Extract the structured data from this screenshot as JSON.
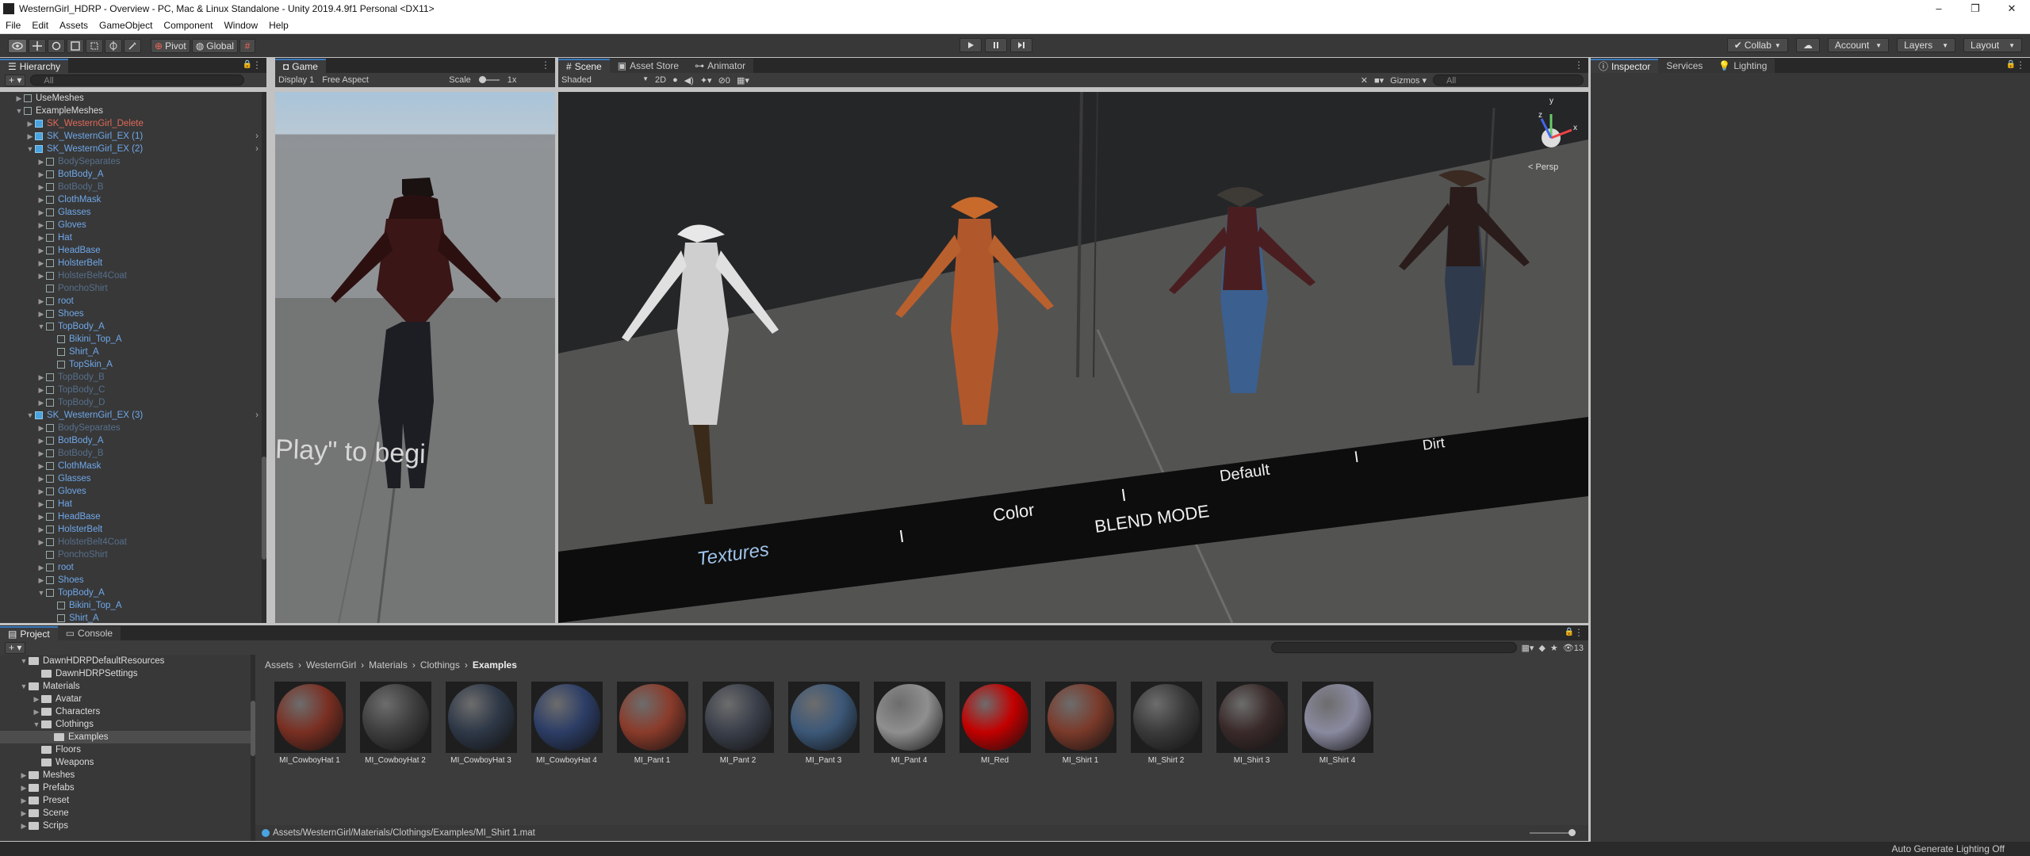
{
  "window": {
    "title": "WesternGirl_HDRP - Overview - PC, Mac & Linux Standalone - Unity 2019.4.9f1 Personal <DX11>",
    "controls": [
      "–",
      "❐",
      "✕"
    ]
  },
  "menubar": [
    "File",
    "Edit",
    "Assets",
    "GameObject",
    "Component",
    "Window",
    "Help"
  ],
  "toolbar": {
    "pivot": "Pivot",
    "global": "Global",
    "collab": "Collab",
    "account": "Account",
    "layers": "Layers",
    "layout": "Layout"
  },
  "hierarchy": {
    "tab": "Hierarchy",
    "search_placeholder": "All",
    "rows": [
      {
        "label": "UseMeshes",
        "indent": 1,
        "color": "#dcdcdc",
        "arrow": "▶",
        "icon": "go"
      },
      {
        "label": "ExampleMeshes",
        "indent": 1,
        "color": "#dcdcdc",
        "arrow": "▼",
        "icon": "go"
      },
      {
        "label": "SK_WesternGirl_Delete",
        "indent": 2,
        "color": "#e06a5a",
        "arrow": "▶",
        "icon": "prefab"
      },
      {
        "label": "SK_WesternGirl_EX (1)",
        "indent": 2,
        "color": "#6fa8ea",
        "arrow": "▶",
        "icon": "prefab"
      },
      {
        "label": "SK_WesternGirl_EX (2)",
        "indent": 2,
        "color": "#6fa8ea",
        "arrow": "▼",
        "icon": "prefab"
      },
      {
        "label": "BodySeparates",
        "indent": 3,
        "color": "#566f8c",
        "arrow": "▶",
        "icon": "go"
      },
      {
        "label": "BotBody_A",
        "indent": 3,
        "color": "#6fa8ea",
        "arrow": "▶",
        "icon": "go"
      },
      {
        "label": "BotBody_B",
        "indent": 3,
        "color": "#566f8c",
        "arrow": "▶",
        "icon": "go"
      },
      {
        "label": "ClothMask",
        "indent": 3,
        "color": "#6fa8ea",
        "arrow": "▶",
        "icon": "go"
      },
      {
        "label": "Glasses",
        "indent": 3,
        "color": "#6fa8ea",
        "arrow": "▶",
        "icon": "go"
      },
      {
        "label": "Gloves",
        "indent": 3,
        "color": "#6fa8ea",
        "arrow": "▶",
        "icon": "go"
      },
      {
        "label": "Hat",
        "indent": 3,
        "color": "#6fa8ea",
        "arrow": "▶",
        "icon": "go"
      },
      {
        "label": "HeadBase",
        "indent": 3,
        "color": "#6fa8ea",
        "arrow": "▶",
        "icon": "go"
      },
      {
        "label": "HolsterBelt",
        "indent": 3,
        "color": "#6fa8ea",
        "arrow": "▶",
        "icon": "go"
      },
      {
        "label": "HolsterBelt4Coat",
        "indent": 3,
        "color": "#566f8c",
        "arrow": "▶",
        "icon": "go"
      },
      {
        "label": "PonchoShirt",
        "indent": 3,
        "color": "#566f8c",
        "arrow": "",
        "icon": "go"
      },
      {
        "label": "root",
        "indent": 3,
        "color": "#6fa8ea",
        "arrow": "▶",
        "icon": "go"
      },
      {
        "label": "Shoes",
        "indent": 3,
        "color": "#6fa8ea",
        "arrow": "▶",
        "icon": "go"
      },
      {
        "label": "TopBody_A",
        "indent": 3,
        "color": "#6fa8ea",
        "arrow": "▼",
        "icon": "go"
      },
      {
        "label": "Bikini_Top_A",
        "indent": 4,
        "color": "#6fa8ea",
        "arrow": "",
        "icon": "go"
      },
      {
        "label": "Shirt_A",
        "indent": 4,
        "color": "#6fa8ea",
        "arrow": "",
        "icon": "go"
      },
      {
        "label": "TopSkin_A",
        "indent": 4,
        "color": "#6fa8ea",
        "arrow": "",
        "icon": "go"
      },
      {
        "label": "TopBody_B",
        "indent": 3,
        "color": "#566f8c",
        "arrow": "▶",
        "icon": "go"
      },
      {
        "label": "TopBody_C",
        "indent": 3,
        "color": "#566f8c",
        "arrow": "▶",
        "icon": "go"
      },
      {
        "label": "TopBody_D",
        "indent": 3,
        "color": "#566f8c",
        "arrow": "▶",
        "icon": "go"
      },
      {
        "label": "SK_WesternGirl_EX (3)",
        "indent": 2,
        "color": "#6fa8ea",
        "arrow": "▼",
        "icon": "prefab"
      },
      {
        "label": "BodySeparates",
        "indent": 3,
        "color": "#566f8c",
        "arrow": "▶",
        "icon": "go"
      },
      {
        "label": "BotBody_A",
        "indent": 3,
        "color": "#6fa8ea",
        "arrow": "▶",
        "icon": "go"
      },
      {
        "label": "BotBody_B",
        "indent": 3,
        "color": "#566f8c",
        "arrow": "▶",
        "icon": "go"
      },
      {
        "label": "ClothMask",
        "indent": 3,
        "color": "#6fa8ea",
        "arrow": "▶",
        "icon": "go"
      },
      {
        "label": "Glasses",
        "indent": 3,
        "color": "#6fa8ea",
        "arrow": "▶",
        "icon": "go"
      },
      {
        "label": "Gloves",
        "indent": 3,
        "color": "#6fa8ea",
        "arrow": "▶",
        "icon": "go"
      },
      {
        "label": "Hat",
        "indent": 3,
        "color": "#6fa8ea",
        "arrow": "▶",
        "icon": "go"
      },
      {
        "label": "HeadBase",
        "indent": 3,
        "color": "#6fa8ea",
        "arrow": "▶",
        "icon": "go"
      },
      {
        "label": "HolsterBelt",
        "indent": 3,
        "color": "#6fa8ea",
        "arrow": "▶",
        "icon": "go"
      },
      {
        "label": "HolsterBelt4Coat",
        "indent": 3,
        "color": "#566f8c",
        "arrow": "▶",
        "icon": "go"
      },
      {
        "label": "PonchoShirt",
        "indent": 3,
        "color": "#566f8c",
        "arrow": "",
        "icon": "go"
      },
      {
        "label": "root",
        "indent": 3,
        "color": "#6fa8ea",
        "arrow": "▶",
        "icon": "go"
      },
      {
        "label": "Shoes",
        "indent": 3,
        "color": "#6fa8ea",
        "arrow": "▶",
        "icon": "go"
      },
      {
        "label": "TopBody_A",
        "indent": 3,
        "color": "#6fa8ea",
        "arrow": "▼",
        "icon": "go"
      },
      {
        "label": "Bikini_Top_A",
        "indent": 4,
        "color": "#6fa8ea",
        "arrow": "",
        "icon": "go"
      },
      {
        "label": "Shirt_A",
        "indent": 4,
        "color": "#6fa8ea",
        "arrow": "",
        "icon": "go"
      }
    ]
  },
  "game": {
    "tab": "Game",
    "display": "Display 1",
    "aspect": "Free Aspect",
    "scale_label": "Scale",
    "scale_value": "1x",
    "overlay_text": "Play\" to begi"
  },
  "scene": {
    "tabs": [
      "Scene",
      "Asset Store",
      "Animator"
    ],
    "draw_mode": "Shaded",
    "mode_2d": "2D",
    "gizmos": "Gizmos",
    "search_placeholder": "All",
    "persp": "< Persp",
    "gizmo_axes": [
      "y",
      "z",
      "x"
    ],
    "floor_labels": [
      "Textures",
      "I",
      "Color",
      "I",
      "Default",
      "I",
      "Dirt"
    ],
    "blend_mode": "BLEND MODE"
  },
  "inspector": {
    "tabs": [
      "Inspector",
      "Services",
      "Lighting"
    ]
  },
  "project": {
    "tabs": [
      "Project",
      "Console"
    ],
    "tree": [
      {
        "label": "DawnHDRPDefaultResources",
        "indent": 1,
        "arrow": "▼",
        "selected": false
      },
      {
        "label": "DawnHDRPSettings",
        "indent": 2,
        "arrow": "",
        "selected": false
      },
      {
        "label": "Materials",
        "indent": 1,
        "arrow": "▼",
        "selected": false
      },
      {
        "label": "Avatar",
        "indent": 2,
        "arrow": "▶",
        "selected": false
      },
      {
        "label": "Characters",
        "indent": 2,
        "arrow": "▶",
        "selected": false
      },
      {
        "label": "Clothings",
        "indent": 2,
        "arrow": "▼",
        "selected": false
      },
      {
        "label": "Examples",
        "indent": 3,
        "arrow": "",
        "selected": true
      },
      {
        "label": "Floors",
        "indent": 2,
        "arrow": "",
        "selected": false
      },
      {
        "label": "Weapons",
        "indent": 2,
        "arrow": "",
        "selected": false
      },
      {
        "label": "Meshes",
        "indent": 1,
        "arrow": "▶",
        "selected": false
      },
      {
        "label": "Prefabs",
        "indent": 1,
        "arrow": "▶",
        "selected": false
      },
      {
        "label": "Preset",
        "indent": 1,
        "arrow": "▶",
        "selected": false
      },
      {
        "label": "Scene",
        "indent": 1,
        "arrow": "▶",
        "selected": false
      },
      {
        "label": "Scrips",
        "indent": 1,
        "arrow": "▶",
        "selected": false
      }
    ],
    "breadcrumb": [
      "Assets",
      "WesternGirl",
      "Materials",
      "Clothings",
      "Examples"
    ],
    "hidden_count": "13",
    "assets": [
      {
        "name": "MI_CowboyHat 1",
        "color": "#7a2f22"
      },
      {
        "name": "MI_CowboyHat 2",
        "color": "#3e3e3e"
      },
      {
        "name": "MI_CowboyHat 3",
        "color": "#2e3847"
      },
      {
        "name": "MI_CowboyHat 4",
        "color": "#2c3d66"
      },
      {
        "name": "MI_Pant 1",
        "color": "#8a3b2a"
      },
      {
        "name": "MI_Pant 2",
        "color": "#3a3f4a"
      },
      {
        "name": "MI_Pant 3",
        "color": "#3c5878"
      },
      {
        "name": "MI_Pant 4",
        "color": "#8f8f8f"
      },
      {
        "name": "MI_Red",
        "color": "#c30000"
      },
      {
        "name": "MI_Shirt 1",
        "color": "#7a3a2a"
      },
      {
        "name": "MI_Shirt 2",
        "color": "#3a3a3a"
      },
      {
        "name": "MI_Shirt 3",
        "color": "#3a2a2a"
      },
      {
        "name": "MI_Shirt 4",
        "color": "#8a8aa0"
      }
    ],
    "selected_path": "Assets/WesternGirl/Materials/Clothings/Examples/MI_Shirt 1.mat"
  },
  "status": {
    "right_text": "Auto Generate Lighting Off"
  },
  "colors": {
    "accent": "#3a79bb",
    "panel_bg": "#383838",
    "prefab_blue": "#4aa3df"
  }
}
